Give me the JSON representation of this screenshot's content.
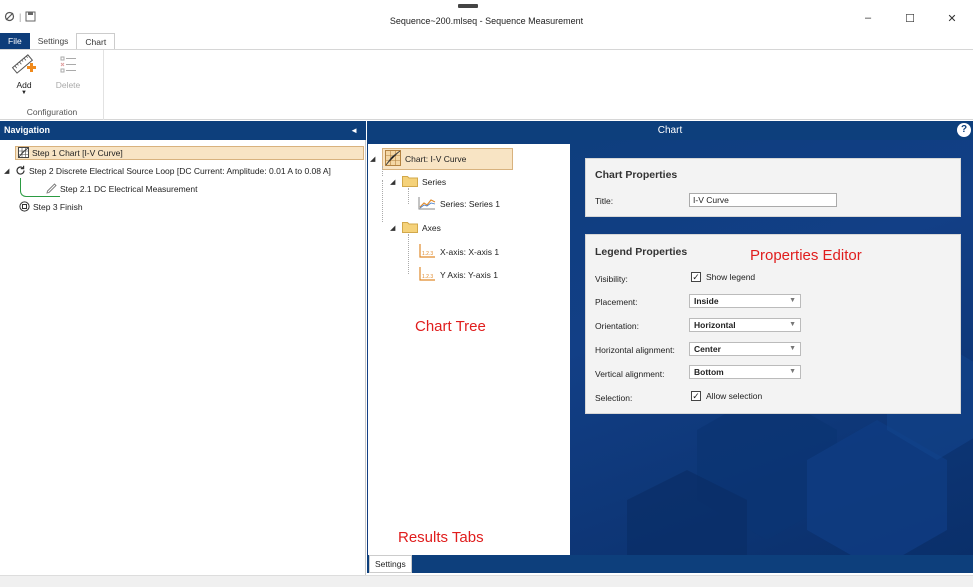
{
  "window": {
    "title": "Sequence~200.mlseq - Sequence Measurement",
    "controls": [
      "–",
      "☐",
      "✕"
    ]
  },
  "ribbon": {
    "tabs": [
      "File",
      "Settings",
      "Chart"
    ],
    "active_tab": "Chart",
    "add_label": "Add",
    "delete_label": "Delete",
    "group_label": "Configuration"
  },
  "navigation": {
    "header": "Navigation",
    "collapse_glyph": "◄",
    "items": [
      {
        "label": "Step 1 Chart [I-V Curve]"
      },
      {
        "label": "Step 2 Discrete Electrical Source Loop [DC Current: Amplitude: 0.01 A to 0.08 A]"
      },
      {
        "label": "Step 2.1 DC Electrical Measurement"
      },
      {
        "label": "Step 3 Finish"
      }
    ]
  },
  "chart_panel": {
    "header": "Chart",
    "help": "?",
    "tree": {
      "root": "Chart: I-V Curve",
      "series_folder": "Series",
      "series_item": "Series: Series 1",
      "axes_folder": "Axes",
      "x_axis": "X-axis: X-axis 1",
      "y_axis": "Y Axis: Y-axis 1",
      "axis_icon_text": "1.2.3"
    },
    "chart_properties": {
      "title": "Chart Properties",
      "title_label": "Title:",
      "title_value": "I-V Curve"
    },
    "legend_properties": {
      "title": "Legend Properties",
      "visibility_label": "Visibility:",
      "visibility_value": "Show legend",
      "placement_label": "Placement:",
      "placement_value": "Inside",
      "orientation_label": "Orientation:",
      "orientation_value": "Horizontal",
      "halign_label": "Horizontal alignment:",
      "halign_value": "Center",
      "valign_label": "Vertical alignment:",
      "valign_value": "Bottom",
      "selection_label": "Selection:",
      "selection_value": "Allow selection"
    },
    "bottom_tab": "Settings"
  },
  "annotations": {
    "properties_editor": "Properties Editor",
    "chart_tree": "Chart Tree",
    "results_tabs": "Results Tabs",
    "color": "#e01d1d"
  },
  "colors": {
    "header_blue": "#0d3f7c",
    "selection": "#f8e4c4",
    "loop_green": "#2b9b42"
  }
}
